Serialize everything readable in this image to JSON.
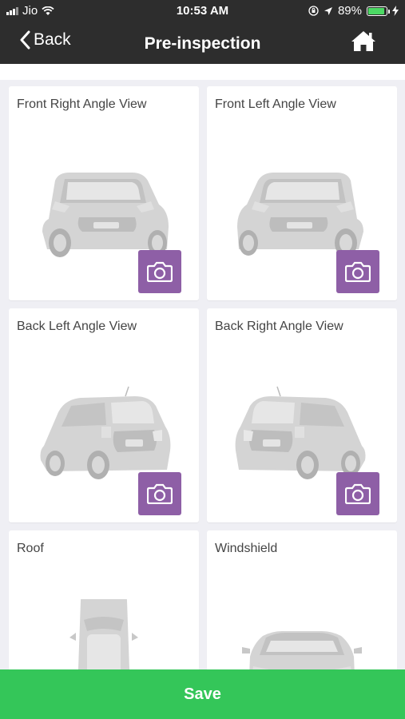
{
  "status_bar": {
    "carrier": "Jio",
    "time": "10:53 AM",
    "battery": "89%",
    "battery_level": 0.89
  },
  "nav": {
    "back_label": "Back",
    "title": "Pre-inspection",
    "home_icon": "home-icon"
  },
  "cards": [
    {
      "title": "Front Right Angle View",
      "car_view": "front-right",
      "camera_icon": "camera-icon"
    },
    {
      "title": "Front Left Angle View",
      "car_view": "front-left",
      "camera_icon": "camera-icon"
    },
    {
      "title": "Back Left Angle View",
      "car_view": "back-left",
      "camera_icon": "camera-icon"
    },
    {
      "title": "Back Right Angle View",
      "car_view": "back-right",
      "camera_icon": "camera-icon"
    },
    {
      "title": "Roof",
      "car_view": "roof",
      "camera_icon": "camera-icon"
    },
    {
      "title": "Windshield",
      "car_view": "windshield",
      "camera_icon": "camera-icon"
    }
  ],
  "save_label": "Save",
  "colors": {
    "header": "#2d2d2d",
    "camera_button": "#8e5fa6",
    "save_button": "#34c659",
    "background": "#efeff4"
  }
}
